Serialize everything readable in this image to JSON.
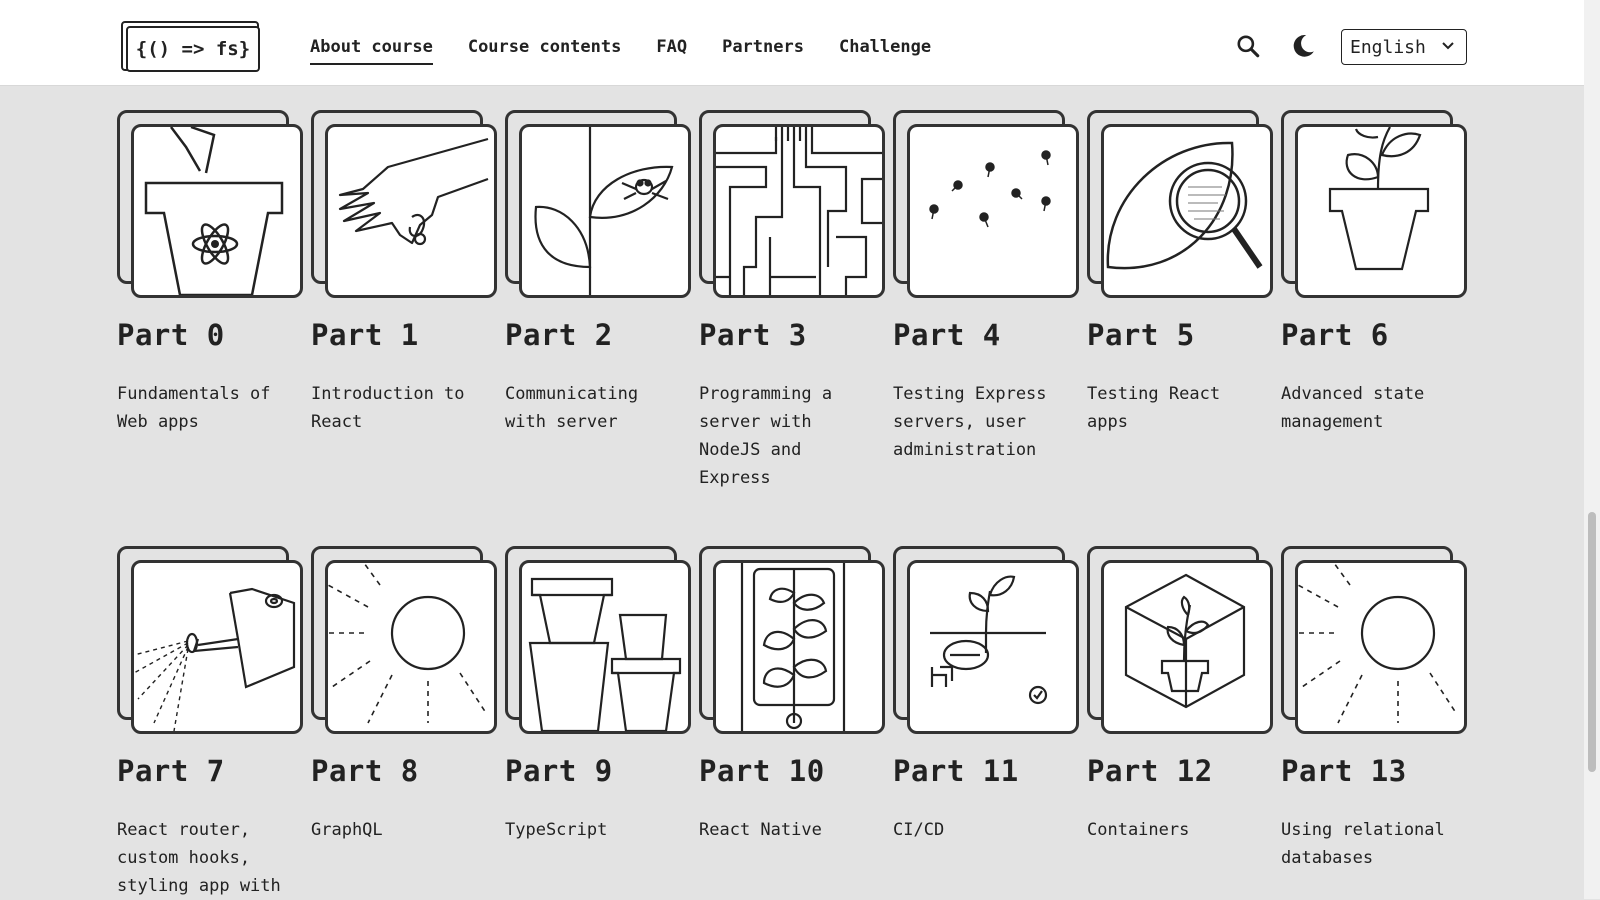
{
  "header": {
    "logo_text": "{() => fs}",
    "nav": [
      {
        "label": "About course",
        "active": true
      },
      {
        "label": "Course contents",
        "active": false
      },
      {
        "label": "FAQ",
        "active": false
      },
      {
        "label": "Partners",
        "active": false
      },
      {
        "label": "Challenge",
        "active": false
      }
    ],
    "search_icon": "search-icon",
    "theme_icon": "moon-icon",
    "language": "English"
  },
  "parts": [
    {
      "title": "Part 0",
      "desc": "Fundamentals of Web apps",
      "icon": "flowerpot-react-icon"
    },
    {
      "title": "Part 1",
      "desc": "Introduction to React",
      "icon": "hand-seed-icon"
    },
    {
      "title": "Part 2",
      "desc": "Communicating with server",
      "icon": "leaf-bug-icon"
    },
    {
      "title": "Part 3",
      "desc": "Programming a server with NodeJS and Express",
      "icon": "circuit-maze-icon"
    },
    {
      "title": "Part 4",
      "desc": "Testing Express servers, user administration",
      "icon": "seeds-icon"
    },
    {
      "title": "Part 5",
      "desc": "Testing React apps",
      "icon": "leaf-magnifier-icon"
    },
    {
      "title": "Part 6",
      "desc": "Advanced state management",
      "icon": "potted-plant-icon"
    },
    {
      "title": "Part 7",
      "desc": "React router, custom hooks, styling app with",
      "icon": "watering-can-icon"
    },
    {
      "title": "Part 8",
      "desc": "GraphQL",
      "icon": "sun-icon"
    },
    {
      "title": "Part 9",
      "desc": "TypeScript",
      "icon": "stacked-pots-icon"
    },
    {
      "title": "Part 10",
      "desc": "React Native",
      "icon": "phone-vine-icon"
    },
    {
      "title": "Part 11",
      "desc": "CI/CD",
      "icon": "sprout-pipeline-icon"
    },
    {
      "title": "Part 12",
      "desc": "Containers",
      "icon": "container-plant-icon"
    },
    {
      "title": "Part 13",
      "desc": "Using relational databases",
      "icon": "sun-icon"
    }
  ]
}
